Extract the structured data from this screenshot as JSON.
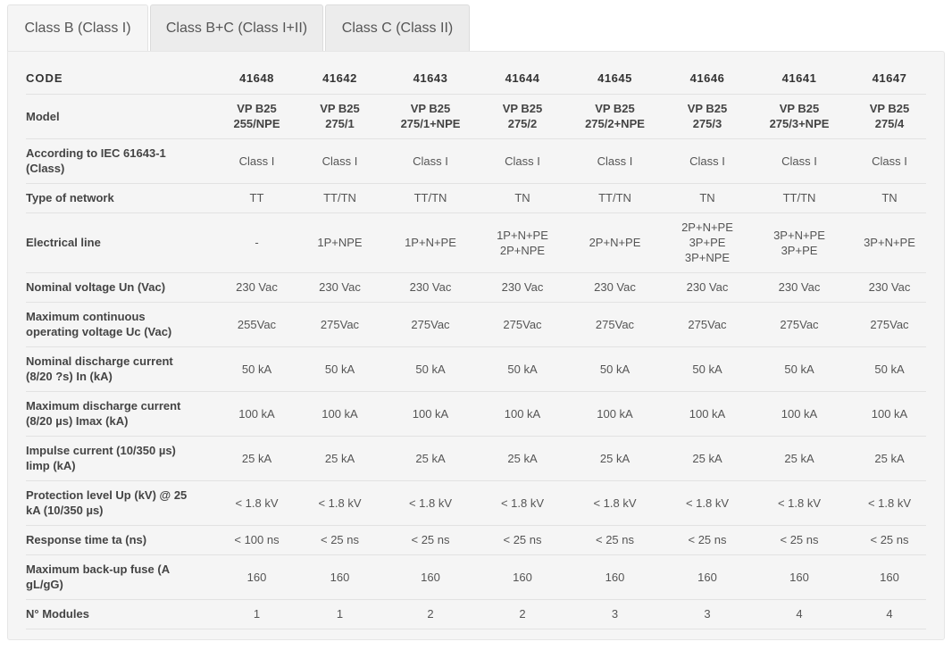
{
  "tabs": [
    {
      "label": "Class B (Class I)",
      "active": true
    },
    {
      "label": "Class B+C (Class I+II)",
      "active": false
    },
    {
      "label": "Class C (Class II)",
      "active": false
    }
  ],
  "table": {
    "rows": [
      {
        "label": "CODE",
        "values": [
          "41648",
          "41642",
          "41643",
          "41644",
          "41645",
          "41646",
          "41641",
          "41647"
        ]
      },
      {
        "label": "Model",
        "values": [
          "VP B25\n255/NPE",
          "VP B25\n275/1",
          "VP B25\n275/1+NPE",
          "VP B25\n275/2",
          "VP B25\n275/2+NPE",
          "VP B25\n275/3",
          "VP B25\n275/3+NPE",
          "VP B25\n275/4"
        ]
      },
      {
        "label": "According to IEC 61643-1\n(Class)",
        "values": [
          "Class I",
          "Class I",
          "Class I",
          "Class I",
          "Class I",
          "Class I",
          "Class I",
          "Class I"
        ]
      },
      {
        "label": "Type of network",
        "values": [
          "TT",
          "TT/TN",
          "TT/TN",
          "TN",
          "TT/TN",
          "TN",
          "TT/TN",
          "TN"
        ]
      },
      {
        "label": "Electrical line",
        "values": [
          "-",
          "1P+NPE",
          "1P+N+PE",
          "1P+N+PE\n2P+NPE",
          "2P+N+PE",
          "2P+N+PE\n3P+PE\n3P+NPE",
          "3P+N+PE\n3P+PE",
          "3P+N+PE"
        ]
      },
      {
        "label": "Nominal voltage Un (Vac)",
        "values": [
          "230 Vac",
          "230 Vac",
          "230 Vac",
          "230 Vac",
          "230 Vac",
          "230 Vac",
          "230 Vac",
          "230 Vac"
        ]
      },
      {
        "label": "Maximum continuous\noperating voltage Uc (Vac)",
        "values": [
          "255Vac",
          "275Vac",
          "275Vac",
          "275Vac",
          "275Vac",
          "275Vac",
          "275Vac",
          "275Vac"
        ]
      },
      {
        "label": "Nominal discharge current\n(8/20 ?s) In (kA)",
        "values": [
          "50 kA",
          "50 kA",
          "50 kA",
          "50 kA",
          "50 kA",
          "50 kA",
          "50 kA",
          "50 kA"
        ]
      },
      {
        "label": "Maximum discharge current\n(8/20 µs) Imax (kA)",
        "values": [
          "100 kA",
          "100 kA",
          "100 kA",
          "100 kA",
          "100 kA",
          "100 kA",
          "100 kA",
          "100 kA"
        ]
      },
      {
        "label": "Impulse current (10/350 µs)\nIimp (kA)",
        "values": [
          "25 kA",
          "25 kA",
          "25 kA",
          "25 kA",
          "25 kA",
          "25 kA",
          "25 kA",
          "25 kA"
        ]
      },
      {
        "label": "Protection level Up (kV) @ 25\nkA (10/350 µs)",
        "values": [
          "< 1.8 kV",
          "< 1.8 kV",
          "< 1.8 kV",
          "< 1.8 kV",
          "< 1.8 kV",
          "< 1.8 kV",
          "< 1.8 kV",
          "< 1.8 kV"
        ]
      },
      {
        "label": "Response time ta (ns)",
        "values": [
          "< 100 ns",
          "< 25 ns",
          "< 25 ns",
          "< 25 ns",
          "< 25 ns",
          "< 25 ns",
          "< 25 ns",
          "< 25 ns"
        ]
      },
      {
        "label": "Maximum back-up fuse (A\ngL/gG)",
        "values": [
          "160",
          "160",
          "160",
          "160",
          "160",
          "160",
          "160",
          "160"
        ]
      },
      {
        "label": "N° Modules",
        "values": [
          "1",
          "1",
          "2",
          "2",
          "3",
          "3",
          "4",
          "4"
        ]
      }
    ]
  }
}
